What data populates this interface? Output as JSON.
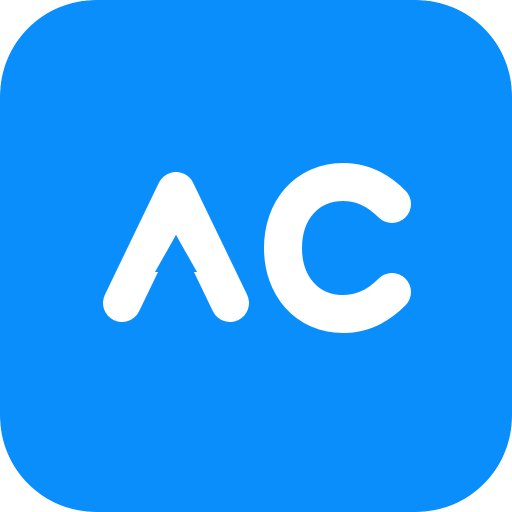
{
  "icon": {
    "name": "ac-icon",
    "letters": "AC",
    "colors": {
      "background": "#0A8EFB",
      "glyph": "#FFFFFF"
    }
  }
}
